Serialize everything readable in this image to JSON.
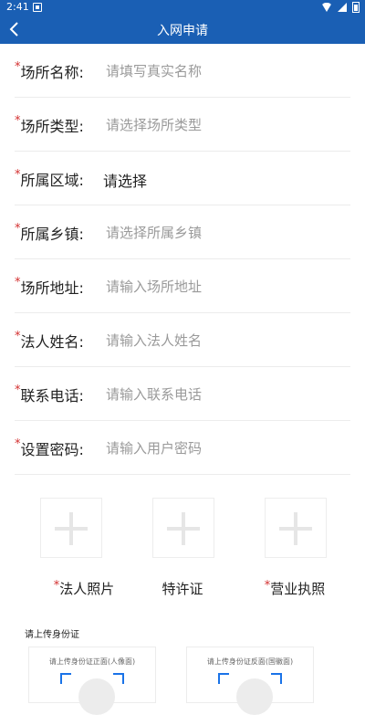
{
  "statusbar": {
    "time": "2:41"
  },
  "nav": {
    "title": "入网申请"
  },
  "form": {
    "required_mark": "*",
    "rows": [
      {
        "label": "场所名称:",
        "placeholder": "请填写真实名称"
      },
      {
        "label": "场所类型:",
        "placeholder": "请选择场所类型"
      },
      {
        "label": "所属区域:",
        "value": "请选择"
      },
      {
        "label": "所属乡镇:",
        "placeholder": "请选择所属乡镇"
      },
      {
        "label": "场所地址:",
        "placeholder": "请输入场所地址"
      },
      {
        "label": "法人姓名:",
        "placeholder": "请输入法人姓名"
      },
      {
        "label": "联系电话:",
        "placeholder": "请输入联系电话"
      },
      {
        "label": "设置密码:",
        "placeholder": "请输入用户密码"
      }
    ]
  },
  "uploads": [
    {
      "label": "法人照片",
      "required": true
    },
    {
      "label": "特许证",
      "required": false
    },
    {
      "label": "营业执照",
      "required": true
    }
  ],
  "id_section": {
    "title": "请上传身份证",
    "front_hint": "请上传身份证正面(人像面)",
    "back_hint": "请上传身份证反面(国徽面)"
  }
}
